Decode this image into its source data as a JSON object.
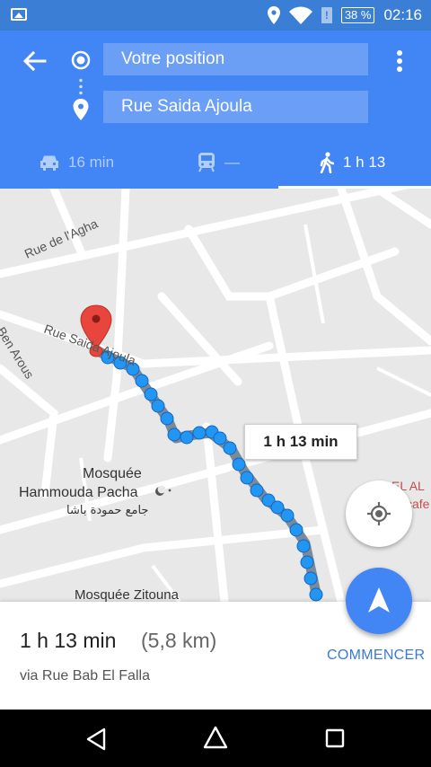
{
  "status_bar": {
    "battery": "38 %",
    "time": "02:16",
    "sim_mark": "!",
    "icons": [
      "image-icon",
      "location-icon",
      "wifi-icon",
      "sim-alert-icon",
      "battery-icon"
    ]
  },
  "header": {
    "origin": "Votre position",
    "destination": "Rue Saida Ajoula",
    "icons": [
      "back-arrow-icon",
      "origin-dot-icon",
      "destination-pin-icon",
      "more-vert-icon"
    ]
  },
  "modes": [
    {
      "label": "16 min",
      "icon": "car-icon",
      "selected": false
    },
    {
      "label": "—",
      "icon": "transit-icon",
      "selected": false
    },
    {
      "label": "1 h 13",
      "icon": "walk-icon",
      "selected": true
    }
  ],
  "map": {
    "labels": {
      "rue_aghа": "Rue de l'Agha",
      "rue_saida": "Rue Saida Ajoula",
      "ben_arous": "Ben Arous",
      "mosquee_h1": "Mosquée",
      "mosquee_h2": "Hammouda Pacha",
      "mosquee_h_ar": "جامع حمودة باشا",
      "mosquee_z": "Mosquée Zitouna",
      "el_al": "EL AL",
      "cafe": "cafe"
    },
    "duration_bubble": "1 h 13 min",
    "accent_route_color": "#2196f3",
    "pin_color": "#e8453c",
    "icons": [
      "destination-marker-icon",
      "my-location-icon",
      "mosque-crescent-icon"
    ]
  },
  "panel": {
    "time": "1 h 13 min",
    "distance": "(5,8 km)",
    "via": "via Rue Bab El Falla",
    "start": "COMMENCER",
    "icons": [
      "navigation-arrow-icon"
    ]
  },
  "nav": {
    "icons": [
      "back-triangle-icon",
      "home-circle-icon",
      "recents-square-icon"
    ]
  }
}
